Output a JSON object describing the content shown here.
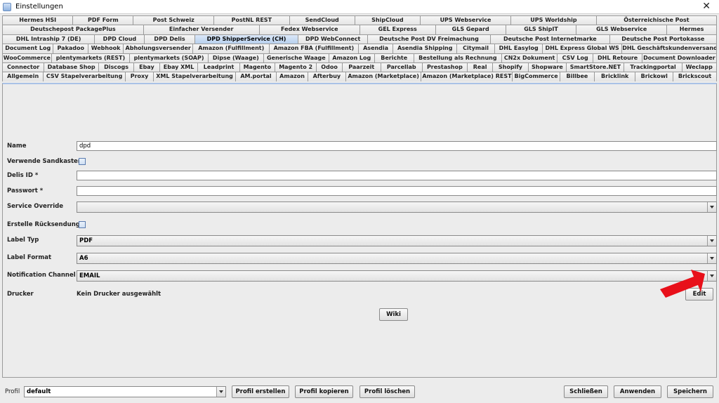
{
  "window": {
    "title": "Einstellungen",
    "close_glyph": "✕",
    "app_icon": "settings-window-icon"
  },
  "tab_rows": [
    [
      "Hermes HSI",
      "PDF Form",
      "Post Schweiz",
      "PostNL REST",
      "SendCloud",
      "ShipCloud",
      "UPS Webservice",
      "UPS Worldship",
      "Österreichische Post"
    ],
    [
      "Deutschepost PackagePlus",
      "Einfacher Versender",
      "Fedex Webservice",
      "GEL Express",
      "GLS Gepard",
      "GLS ShipIT",
      "GLS Webservice",
      "Hermes"
    ],
    [
      "DHL Intraship 7 (DE)",
      "DPD Cloud",
      "DPD Delis",
      "DPD ShipperService (CH)",
      "DPD WebConnect",
      "Deutsche Post DV Freimachung",
      "Deutsche Post Internetmarke",
      "Deutsche Post Portokasse"
    ],
    [
      "Document Log",
      "Pakadoo",
      "Webhook",
      "Abholungsversender",
      "Amazon (Fulfillment)",
      "Amazon FBA (Fulfillment)",
      "Asendia",
      "Asendia Shipping",
      "Citymail",
      "DHL Easylog",
      "DHL Express Global WS",
      "DHL Geschäftskundenversand"
    ],
    [
      "WooCommerce",
      "plentymarkets (REST)",
      "plentymarkets (SOAP)",
      "Dipse (Waage)",
      "Generische Waage",
      "Amazon Log",
      "Berichte",
      "Bestellung als Rechnung",
      "CN2x Dokument",
      "CSV Log",
      "DHL Retoure",
      "Document Downloader"
    ],
    [
      "Connector",
      "Database Shop",
      "Discogs",
      "Ebay",
      "Ebay XML",
      "Leadprint",
      "Magento",
      "Magento 2",
      "Odoo",
      "Paarzeit",
      "Parcellab",
      "Prestashop",
      "Real",
      "Shopify",
      "Shopware",
      "SmartStore.NET",
      "Trackingportal",
      "Weclapp"
    ],
    [
      "Allgemein",
      "CSV Stapelverarbeitung",
      "Proxy",
      "XML Stapelverarbeitung",
      "AM.portal",
      "Amazon",
      "Afterbuy",
      "Amazon (Marketplace)",
      "Amazon (Marketplace) REST",
      "BigCommerce",
      "Billbee",
      "Bricklink",
      "Brickowl",
      "Brickscout"
    ]
  ],
  "active_tab": "DPD ShipperService (CH)",
  "form": {
    "name_label": "Name",
    "name_value": "dpd",
    "sandbox_label": "Verwende Sandkasten",
    "delis_label": "Delis ID *",
    "delis_value": "",
    "password_label": "Passwort *",
    "password_value": "",
    "service_override_label": "Service Override",
    "service_override_value": "",
    "return_label": "Erstelle Rücksendung",
    "label_type_label": "Label Typ",
    "label_type_value": "PDF",
    "label_format_label": "Label Format",
    "label_format_value": "A6",
    "notification_label": "Notification Channel",
    "notification_value": "EMAIL",
    "printer_label": "Drucker",
    "printer_value": "Kein Drucker ausgewählt",
    "edit_button": "Edit",
    "wiki_button": "Wiki"
  },
  "bottom": {
    "profile_label": "Profil",
    "profile_value": "default",
    "create_profile": "Profil erstellen",
    "copy_profile": "Profil kopieren",
    "delete_profile": "Profil löschen",
    "close": "Schließen",
    "apply": "Anwenden",
    "save": "Speichern"
  },
  "colors": {
    "active_tab": "#b8d0ee",
    "arrow": "#e8101a"
  }
}
